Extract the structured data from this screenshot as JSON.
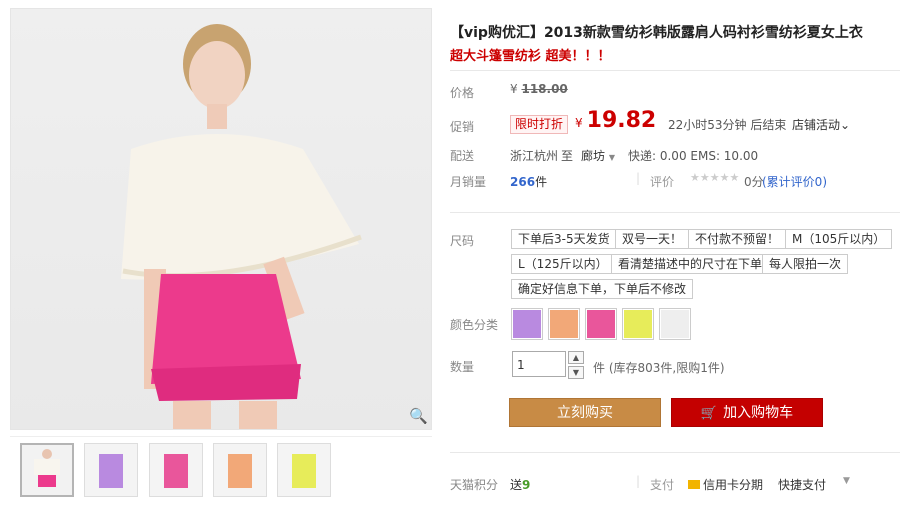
{
  "product": {
    "title": "【vip购优汇】2013新款雪纺衫韩版露肩人码衬衫雪纺衫夏女上衣",
    "subtitle": "超大斗篷雪纺衫 超美！！！"
  },
  "price": {
    "label": "价格",
    "currency": "¥",
    "original": "118.00"
  },
  "promo": {
    "label": "促销",
    "tag": "限时打折",
    "currency": "¥",
    "price": "19.82",
    "countdown": "22小时53分钟 后结束",
    "shop_promo": "店铺活动"
  },
  "shipping": {
    "label": "配送",
    "origin": "浙江杭州",
    "to": "至",
    "dest": "廊坊",
    "info": "快递: 0.00  EMS: 10.00"
  },
  "sales": {
    "label": "月销量",
    "count": "266",
    "unit": "件",
    "rating_label": "评价",
    "rating_score": "0分",
    "review_count": "(累计评价0)"
  },
  "size": {
    "label": "尺码",
    "options": [
      "下单后3-5天发货",
      "双号一天！",
      "不付款不预留！",
      "M（105斤以内）",
      "L（125斤以内）",
      "看清楚描述中的尺寸在下单",
      "每人限拍一次",
      "确定好信息下单，下单后不修改"
    ]
  },
  "color": {
    "label": "颜色分类",
    "swatches": [
      "#b98ae0",
      "#f2a878",
      "#e9569b",
      "#e7ec5a",
      "#eeeeee"
    ]
  },
  "quantity": {
    "label": "数量",
    "value": "1",
    "stock": "件 (库存803件,限购1件)"
  },
  "buttons": {
    "buy": "立刻购买",
    "cart": "加入购物车"
  },
  "bottom": {
    "points_label": "天猫积分",
    "points_prefix": "送",
    "points": "9",
    "pay_label": "支付",
    "credit": "信用卡分期",
    "quick": "快捷支付"
  },
  "colors": {
    "accent_red": "#c40000",
    "buy_orange": "#c88b45"
  }
}
